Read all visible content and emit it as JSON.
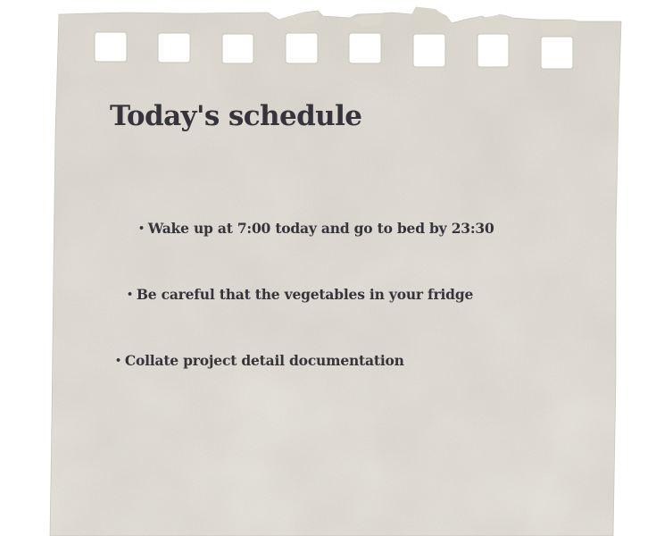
{
  "note": {
    "title": "Today's schedule",
    "items": [
      {
        "bullet": "•",
        "text": "Wake up at 7:00 today and go to bed by 23:30"
      },
      {
        "bullet": "•",
        "text": "Be careful that the vegetables in your fridge"
      },
      {
        "bullet": "•",
        "text": "Collate project detail documentation"
      }
    ]
  },
  "colors": {
    "paper": "#e8e4dc",
    "paper_shadow": "#d6d1c6",
    "text": "#36333d",
    "background": "#ffffff"
  }
}
